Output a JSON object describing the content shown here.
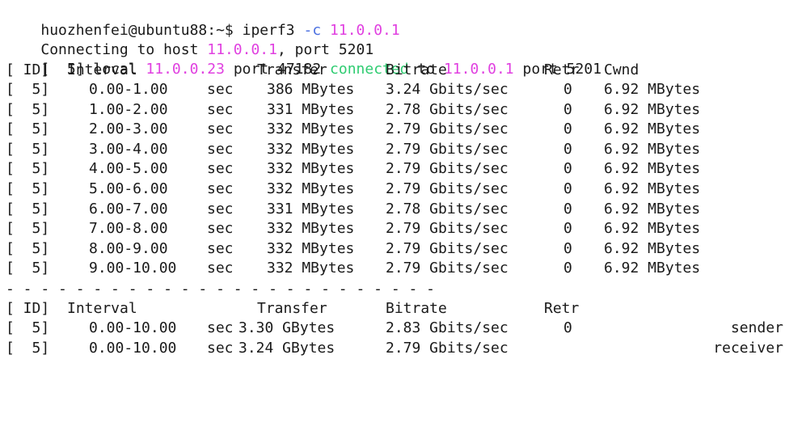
{
  "prompt": {
    "user_host": "huozhenfei@ubuntu88:~$",
    "command": "iperf3",
    "flag": "-c",
    "target": "11.0.0.1"
  },
  "connecting": {
    "prefix": "Connecting to host",
    "host": "11.0.0.1",
    "suffix": ", port 5201"
  },
  "local_line": {
    "id": "[  5]",
    "local": "local",
    "local_ip": "11.0.0.23",
    "port_txt": "port 47182",
    "connected": "connected",
    "to": "to",
    "remote_ip": "11.0.0.1",
    "remote_port": "port 5201"
  },
  "header": {
    "id": "[ ID]",
    "interval": "Interval",
    "transfer": "Transfer",
    "bitrate": "Bitrate",
    "retr": "Retr",
    "cwnd": "Cwnd"
  },
  "rows": [
    {
      "id": "[  5]",
      "interval": "0.00-1.00",
      "unit": "sec",
      "transfer": "386 MBytes",
      "bitrate": "3.24 Gbits/sec",
      "retr": "0",
      "cwnd": "6.92 MBytes"
    },
    {
      "id": "[  5]",
      "interval": "1.00-2.00",
      "unit": "sec",
      "transfer": "331 MBytes",
      "bitrate": "2.78 Gbits/sec",
      "retr": "0",
      "cwnd": "6.92 MBytes"
    },
    {
      "id": "[  5]",
      "interval": "2.00-3.00",
      "unit": "sec",
      "transfer": "332 MBytes",
      "bitrate": "2.79 Gbits/sec",
      "retr": "0",
      "cwnd": "6.92 MBytes"
    },
    {
      "id": "[  5]",
      "interval": "3.00-4.00",
      "unit": "sec",
      "transfer": "332 MBytes",
      "bitrate": "2.79 Gbits/sec",
      "retr": "0",
      "cwnd": "6.92 MBytes"
    },
    {
      "id": "[  5]",
      "interval": "4.00-5.00",
      "unit": "sec",
      "transfer": "332 MBytes",
      "bitrate": "2.79 Gbits/sec",
      "retr": "0",
      "cwnd": "6.92 MBytes"
    },
    {
      "id": "[  5]",
      "interval": "5.00-6.00",
      "unit": "sec",
      "transfer": "332 MBytes",
      "bitrate": "2.79 Gbits/sec",
      "retr": "0",
      "cwnd": "6.92 MBytes"
    },
    {
      "id": "[  5]",
      "interval": "6.00-7.00",
      "unit": "sec",
      "transfer": "331 MBytes",
      "bitrate": "2.78 Gbits/sec",
      "retr": "0",
      "cwnd": "6.92 MBytes"
    },
    {
      "id": "[  5]",
      "interval": "7.00-8.00",
      "unit": "sec",
      "transfer": "332 MBytes",
      "bitrate": "2.79 Gbits/sec",
      "retr": "0",
      "cwnd": "6.92 MBytes"
    },
    {
      "id": "[  5]",
      "interval": "8.00-9.00",
      "unit": "sec",
      "transfer": "332 MBytes",
      "bitrate": "2.79 Gbits/sec",
      "retr": "0",
      "cwnd": "6.92 MBytes"
    },
    {
      "id": "[  5]",
      "interval": "9.00-10.00",
      "unit": "sec",
      "transfer": "332 MBytes",
      "bitrate": "2.79 Gbits/sec",
      "retr": "0",
      "cwnd": "6.92 MBytes"
    }
  ],
  "separator": "- - - - - - - - - - - - - - - - - - - - - - - - -",
  "summary_header": {
    "id": "[ ID]",
    "interval": "Interval",
    "transfer": "Transfer",
    "bitrate": "Bitrate",
    "retr": "Retr"
  },
  "summary": [
    {
      "id": "[  5]",
      "interval": "0.00-10.00",
      "unit": "sec",
      "transfer": "3.30 GBytes",
      "bitrate": "2.83 Gbits/sec",
      "retr": "0",
      "role": "sender"
    },
    {
      "id": "[  5]",
      "interval": "0.00-10.00",
      "unit": "sec",
      "transfer": "3.24 GBytes",
      "bitrate": "2.79 Gbits/sec",
      "retr": "",
      "role": "receiver"
    }
  ]
}
